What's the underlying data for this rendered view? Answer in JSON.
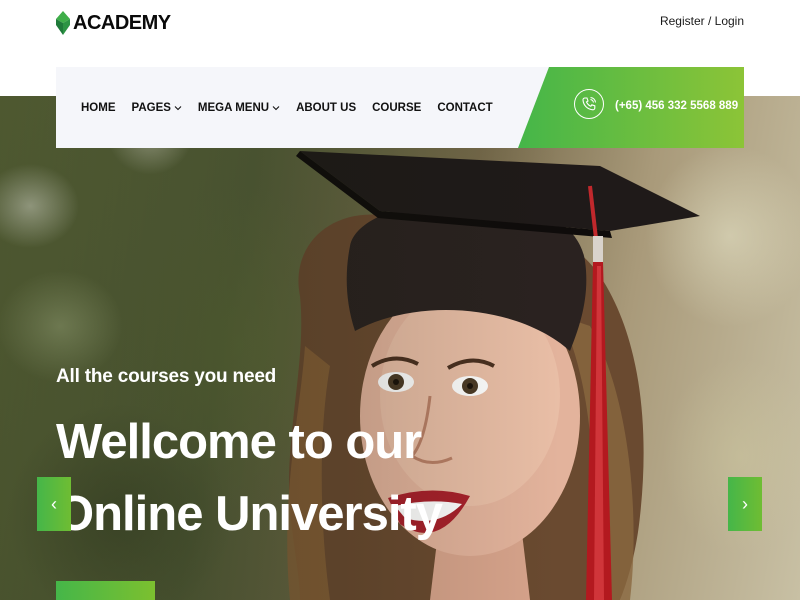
{
  "brand": {
    "name": "ACADEMY",
    "accent_color": "#45b649",
    "accent_color_end": "#8cc437"
  },
  "header": {
    "auth_link": "Register / Login"
  },
  "nav": {
    "items": [
      {
        "label": "HOME",
        "has_dropdown": false
      },
      {
        "label": "PAGES",
        "has_dropdown": true
      },
      {
        "label": "MEGA MENU",
        "has_dropdown": true
      },
      {
        "label": "ABOUT US",
        "has_dropdown": false
      },
      {
        "label": "COURSE",
        "has_dropdown": false
      },
      {
        "label": "CONTACT",
        "has_dropdown": false
      }
    ],
    "phone": {
      "icon": "phone-icon",
      "number": "(+65) 456 332 5568 889"
    }
  },
  "hero": {
    "kicker": "All the courses you need",
    "title_line1": "Wellcome to our",
    "title_line2": "Online University",
    "prev_icon": "chevron-left-icon",
    "next_icon": "chevron-right-icon",
    "prev_glyph": "‹",
    "next_glyph": "›",
    "image": "graduate-woman-in-cap-photo"
  }
}
